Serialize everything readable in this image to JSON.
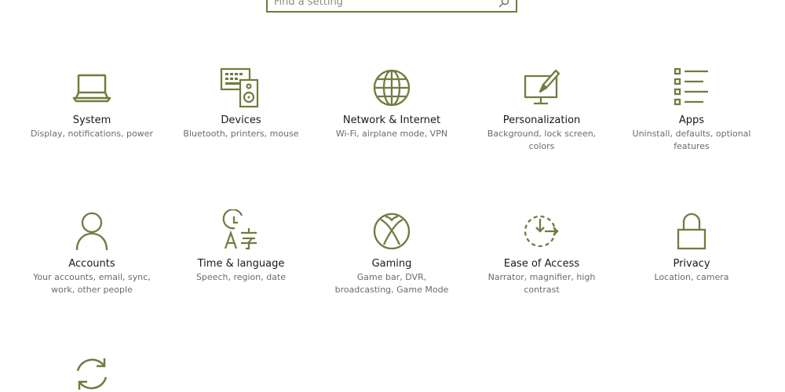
{
  "search": {
    "placeholder": "Find a setting"
  },
  "colors": {
    "accent": "#6f7c3f",
    "title_text": "#1a1a1a",
    "desc_text": "#6b6b6b",
    "background": "#ffffff"
  },
  "tiles": [
    {
      "icon": "laptop-icon",
      "title": "System",
      "desc": "Display, notifications, power"
    },
    {
      "icon": "keyboard-speaker-icon",
      "title": "Devices",
      "desc": "Bluetooth, printers, mouse"
    },
    {
      "icon": "globe-icon",
      "title": "Network & Internet",
      "desc": "Wi-Fi, airplane mode, VPN"
    },
    {
      "icon": "paint-monitor-icon",
      "title": "Personalization",
      "desc": "Background, lock screen, colors"
    },
    {
      "icon": "app-list-icon",
      "title": "Apps",
      "desc": "Uninstall, defaults, optional features"
    },
    {
      "icon": "person-icon",
      "title": "Accounts",
      "desc": "Your accounts, email, sync, work, other people"
    },
    {
      "icon": "time-language-icon",
      "title": "Time & language",
      "desc": "Speech, region, date"
    },
    {
      "icon": "xbox-icon",
      "title": "Gaming",
      "desc": "Game bar, DVR, broadcasting, Game Mode"
    },
    {
      "icon": "ease-of-access-icon",
      "title": "Ease of Access",
      "desc": "Narrator, magnifier, high contrast"
    },
    {
      "icon": "padlock-icon",
      "title": "Privacy",
      "desc": "Location, camera"
    },
    {
      "icon": "sync-arrows-icon",
      "title": "",
      "desc": ""
    }
  ]
}
